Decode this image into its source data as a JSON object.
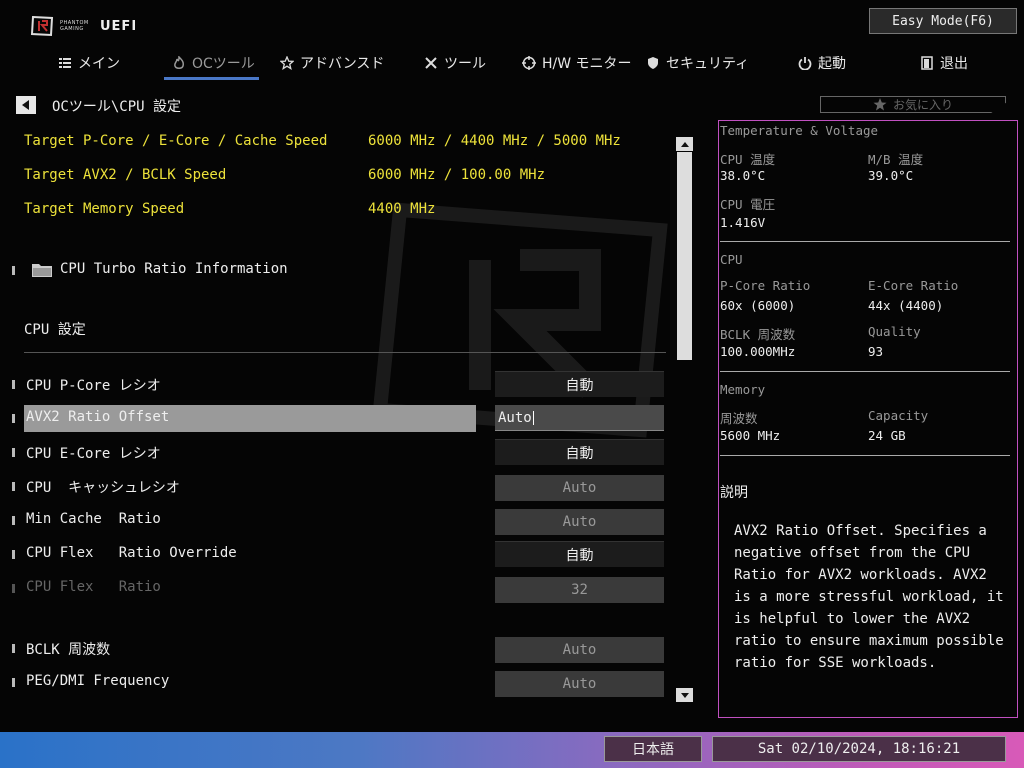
{
  "brand": {
    "small": "PHANTOM GAMING",
    "big": "UEFI"
  },
  "easy_mode": "Easy Mode(F6)",
  "nav": [
    {
      "label": "メイン",
      "icon": "list-icon"
    },
    {
      "label": "OCツール",
      "icon": "flame-icon"
    },
    {
      "label": "アドバンスド",
      "icon": "star-icon"
    },
    {
      "label": "ツール",
      "icon": "tools-icon"
    },
    {
      "label": "H/W モニター",
      "icon": "crosshair-icon"
    },
    {
      "label": "セキュリティ",
      "icon": "shield-icon"
    },
    {
      "label": "起動",
      "icon": "power-icon"
    },
    {
      "label": "退出",
      "icon": "exit-icon"
    }
  ],
  "breadcrumb": "OCツール\\CPU 設定",
  "favorites": "お気に入り",
  "targets": [
    {
      "label": "Target P-Core / E-Core / Cache Speed",
      "value": "6000 MHz / 4400 MHz / 5000 MHz"
    },
    {
      "label": "Target AVX2 / BCLK Speed",
      "value": "6000 MHz / 100.00 MHz"
    },
    {
      "label": "Target Memory Speed",
      "value": "4400 MHz"
    }
  ],
  "turbo_info": "CPU Turbo Ratio Information",
  "section": "CPU 設定",
  "settings": [
    {
      "label": "CPU P-Core レシオ",
      "value": "自動"
    },
    {
      "label": "AVX2 Ratio Offset",
      "value": "Auto"
    },
    {
      "label": "CPU E-Core レシオ",
      "value": "自動"
    },
    {
      "label": "CPU  キャッシュレシオ",
      "value": "Auto"
    },
    {
      "label": "Min Cache  Ratio",
      "value": "Auto"
    },
    {
      "label": "CPU Flex   Ratio Override",
      "value": "自動"
    },
    {
      "label": "CPU Flex   Ratio",
      "value": "32"
    },
    {
      "label": "BCLK 周波数",
      "value": "Auto"
    },
    {
      "label": "PEG/DMI Frequency",
      "value": "Auto"
    }
  ],
  "panel": {
    "title": "Temperature & Voltage",
    "cpu_temp_label": "CPU 温度",
    "cpu_temp": "38.0°C",
    "mb_temp_label": "M/B 温度",
    "mb_temp": "39.0°C",
    "cpu_volt_label": "CPU 電圧",
    "cpu_volt": "1.416V",
    "cpu_head": "CPU",
    "pcore_label": "P-Core Ratio",
    "pcore": "60x (6000)",
    "ecore_label": "E-Core Ratio",
    "ecore": "44x (4400)",
    "bclk_label": "BCLK 周波数",
    "bclk": "100.000MHz",
    "quality_label": "Quality",
    "quality": "93",
    "mem_head": "Memory",
    "freq_label": "周波数",
    "freq": "5600 MHz",
    "cap_label": "Capacity",
    "cap": "24 GB",
    "desc_head": "説明",
    "desc": "AVX2 Ratio Offset. Specifies a negative offset from the CPU Ratio for AVX2 workloads. AVX2 is a more stressful workload, it is helpful to lower the AVX2 ratio to ensure maximum possible ratio for SSE workloads."
  },
  "footer": {
    "language": "日本語",
    "datetime": "Sat 02/10/2024, 18:16:21"
  }
}
